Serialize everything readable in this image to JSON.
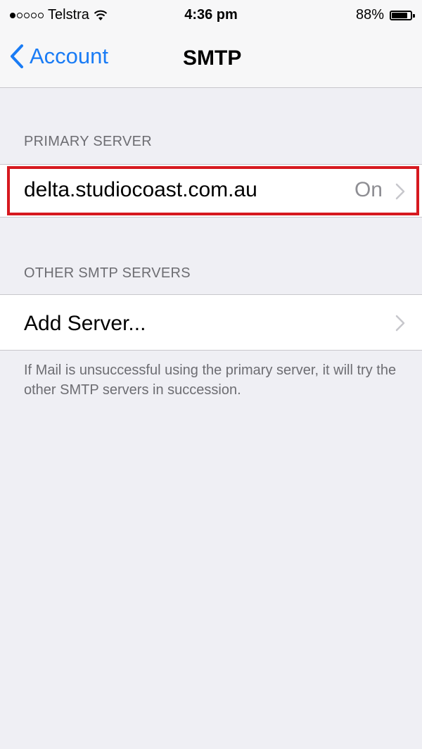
{
  "status_bar": {
    "carrier": "Telstra",
    "time": "4:36 pm",
    "battery": "88%",
    "battery_level": 0.88,
    "signal_strength": 1
  },
  "nav": {
    "back_label": "Account",
    "title": "SMTP"
  },
  "primary_section": {
    "header": "PRIMARY SERVER",
    "server_name": "delta.studiocoast.com.au",
    "server_status": "On"
  },
  "other_section": {
    "header": "OTHER SMTP SERVERS",
    "add_label": "Add Server..."
  },
  "footer": {
    "text": "If Mail is unsuccessful using the primary server, it will try the other SMTP servers in succession."
  },
  "colors": {
    "accent": "#1a7cf5",
    "highlight": "#d6191f",
    "background": "#efeff4"
  }
}
